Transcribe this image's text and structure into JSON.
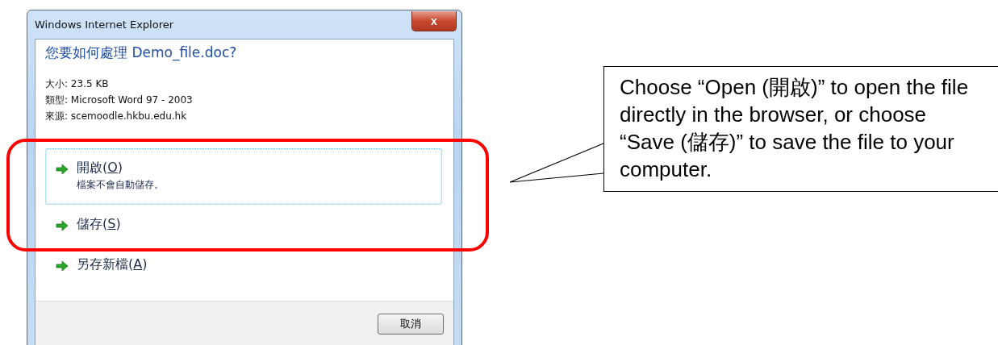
{
  "window": {
    "title": "Windows Internet Explorer",
    "close": "x"
  },
  "dialog": {
    "heading": "您要如何處理 Demo_file.doc?",
    "details": [
      "大小: 23.5 KB",
      "類型: Microsoft Word 97 - 2003",
      "來源: scemoodle.hkbu.edu.hk"
    ],
    "options": [
      {
        "label_before": "開啟(",
        "access_key": "O",
        "label_after": ")",
        "note": "檔案不會自動儲存。",
        "selected": true
      },
      {
        "label_before": "儲存(",
        "access_key": "S",
        "label_after": ")",
        "selected": false
      },
      {
        "label_before": "另存新檔(",
        "access_key": "A",
        "label_after": ")",
        "selected": false
      }
    ],
    "cancel_button": "取消"
  },
  "callout": {
    "text": "Choose “Open (開啟)” to open the file directly in the browser, or choose “Save (儲存)” to save the file to your computer."
  }
}
